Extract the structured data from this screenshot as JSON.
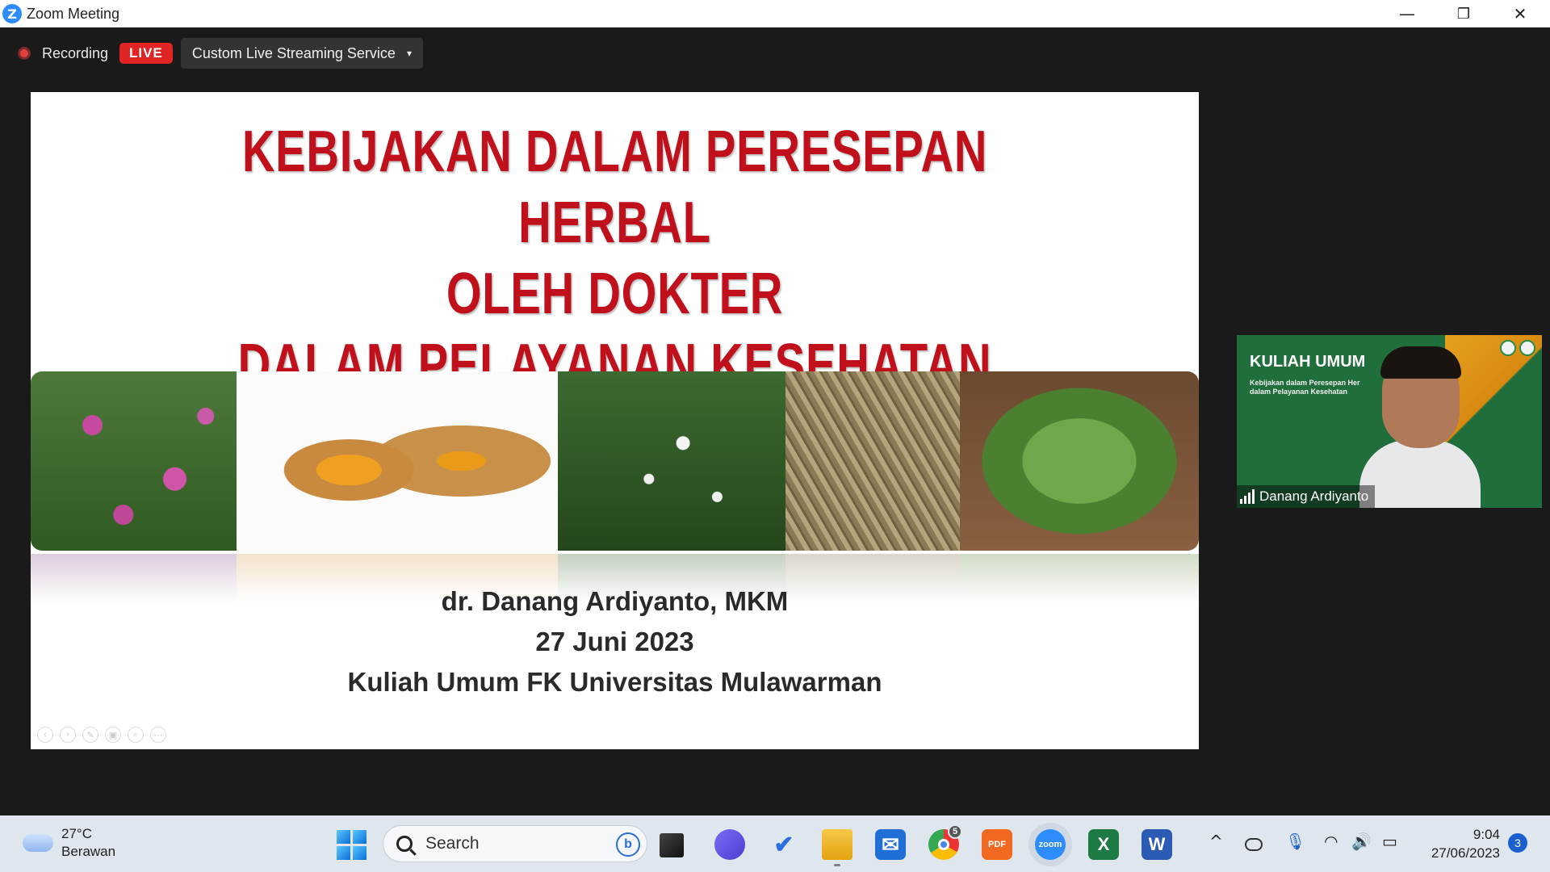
{
  "window": {
    "title": "Zoom Meeting",
    "logo_letter": "Z",
    "controls": {
      "minimize": "—",
      "restore": "❐",
      "close": "✕"
    }
  },
  "recording": {
    "label": "Recording",
    "live_badge": "LIVE",
    "stream_service": "Custom Live Streaming Service",
    "caret": "▾",
    "dot_color": "#e04040"
  },
  "slide": {
    "title_lines": [
      "KEBIJAKAN DALAM PERESEPAN HERBAL",
      "OLEH DOKTER",
      "DALAM PELAYANAN KESEHATAN"
    ],
    "title_color": "#c0101c",
    "images": [
      "echinacea-flowers",
      "turmeric-roots",
      "cat-whiskers-plant",
      "fennel-seeds",
      "leafy-herb-plant"
    ],
    "presenter": "dr. Danang Ardiyanto, MKM",
    "date": "27 Juni 2023",
    "event": "Kuliah Umum FK Universitas Mulawarman",
    "controls": [
      "‹",
      "›",
      "✎",
      "▣",
      "⌕",
      "⋯"
    ]
  },
  "speaker": {
    "name": "Danang Ardiyanto",
    "bg_title": "KULIAH UMUM",
    "bg_subtitle_line1": "Kebijakan dalam Peresepan Her",
    "bg_subtitle_line2": "dalam Pelayanan Kesehatan"
  },
  "taskbar": {
    "weather": {
      "temp": "27°C",
      "condition": "Berawan"
    },
    "search_placeholder": "Search",
    "bing_letter": "b",
    "apps": [
      {
        "name": "start",
        "label": ""
      },
      {
        "name": "task-view",
        "label": ""
      },
      {
        "name": "teams",
        "label": ""
      },
      {
        "name": "todo",
        "label": "✔"
      },
      {
        "name": "file-explorer",
        "label": ""
      },
      {
        "name": "mail",
        "label": "✉"
      },
      {
        "name": "chrome",
        "label": "",
        "badge": "5"
      },
      {
        "name": "pdf",
        "label": "PDF"
      },
      {
        "name": "zoom",
        "label": "zoom"
      },
      {
        "name": "excel",
        "label": "X"
      },
      {
        "name": "word",
        "label": "W"
      }
    ],
    "tray": {
      "chevron": "^",
      "mic": "🎙",
      "wifi": "◠",
      "volume": "🔊",
      "battery": "▭"
    },
    "time": "9:04",
    "date": "27/06/2023",
    "notifications": "3"
  }
}
